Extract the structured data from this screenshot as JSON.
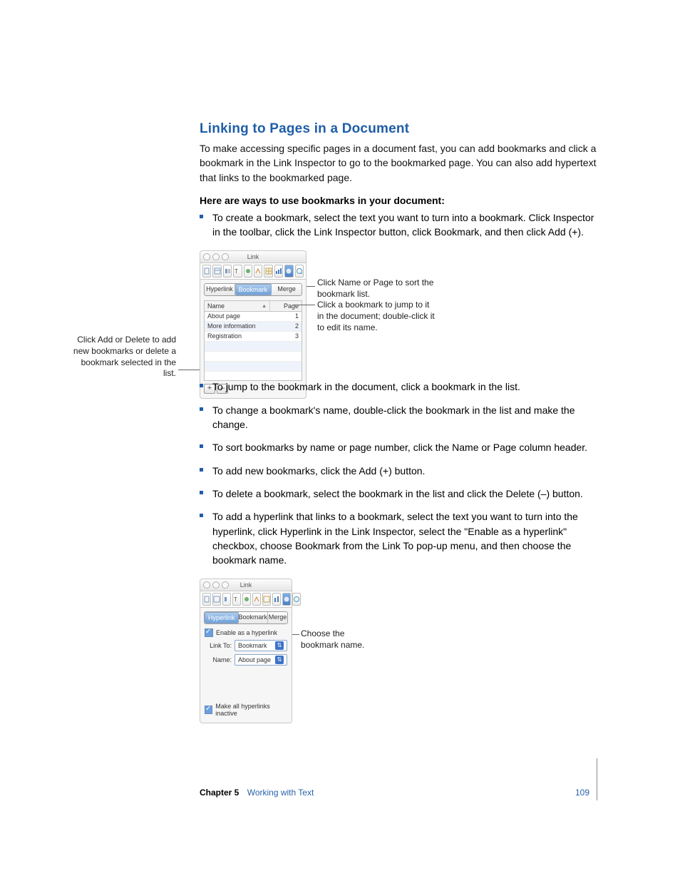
{
  "heading": "Linking to Pages in a Document",
  "intro": "To make accessing specific pages in a document fast, you can add bookmarks and click a bookmark in the Link Inspector to go to the bookmarked page. You can also add hypertext that links to the bookmarked page.",
  "subhead": "Here are ways to use bookmarks in your document:",
  "bullet1": "To create a bookmark, select the text you want to turn into a bookmark. Click Inspector in the toolbar, click the Link Inspector button, click Bookmark, and then click Add (+).",
  "bullets2": [
    "To jump to the bookmark in the document, click a bookmark in the list.",
    "To change a bookmark's name, double-click the bookmark in the list and make the change.",
    "To sort bookmarks by name or page number, click the Name or Page column header.",
    "To add new bookmarks, click the Add (+) button.",
    "To delete a bookmark, select the bookmark in the list and click the Delete (–) button.",
    "To add a hyperlink that links to a bookmark, select the text you want to turn into the hyperlink, click Hyperlink in the Link Inspector, select the \"Enable as a hyperlink\" checkbox, choose Bookmark from the Link To pop-up menu, and then choose the bookmark name."
  ],
  "figure1": {
    "window_title": "Link",
    "tabs": [
      "Hyperlink",
      "Bookmark",
      "Merge"
    ],
    "selected_tab": "Bookmark",
    "columns": {
      "name": "Name",
      "page": "Page"
    },
    "rows": [
      {
        "name": "About page",
        "page": "1"
      },
      {
        "name": "More information",
        "page": "2"
      },
      {
        "name": "Registration",
        "page": "3"
      }
    ],
    "add": "+",
    "del": "–",
    "callouts": {
      "sort": "Click Name or Page to sort the bookmark list.",
      "jump": "Click a bookmark to jump to it in the document; double-click it to edit its name.",
      "adddel": "Click Add or Delete to add new bookmarks or delete a bookmark selected in the list."
    }
  },
  "figure2": {
    "window_title": "Link",
    "tabs": [
      "Hyperlink",
      "Bookmark",
      "Merge"
    ],
    "selected_tab": "Hyperlink",
    "enable_label": "Enable as a hyperlink",
    "linkto_label": "Link To:",
    "linkto_value": "Bookmark",
    "name_label": "Name:",
    "name_value": "About page",
    "inactive_label": "Make all hyperlinks inactive",
    "callout": "Choose the bookmark name."
  },
  "footer": {
    "chapter": "Chapter 5",
    "title": "Working with Text",
    "page": "109"
  }
}
